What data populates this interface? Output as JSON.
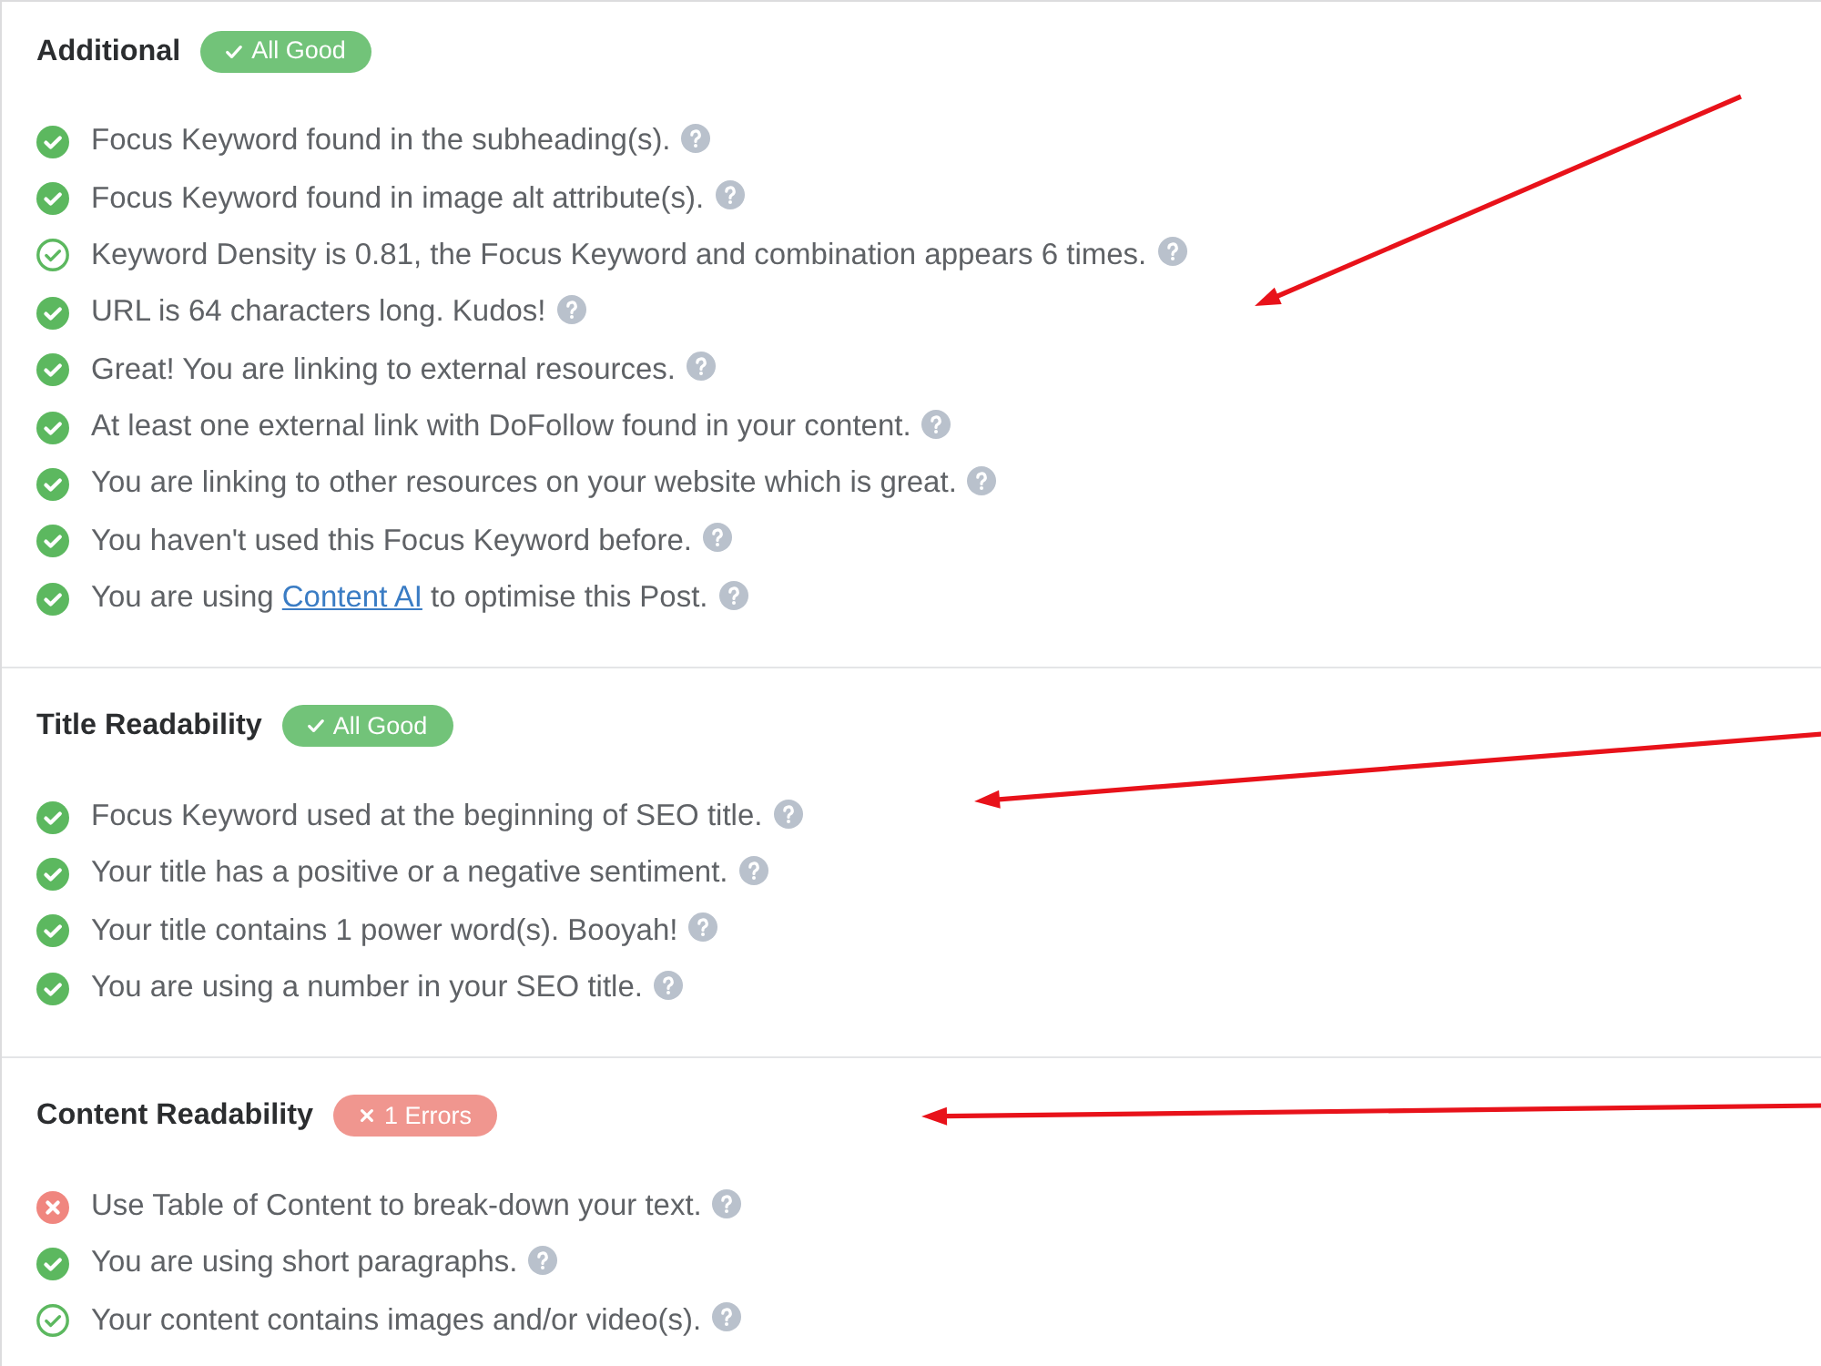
{
  "sections": [
    {
      "title": "Additional",
      "badge": {
        "has_errors": false,
        "label": "All Good"
      },
      "annotation_arrow": true,
      "items": [
        {
          "passed": true,
          "outlined": false,
          "text": "Focus Keyword found in the subheading(s)."
        },
        {
          "passed": true,
          "outlined": false,
          "text": "Focus Keyword found in image alt attribute(s)."
        },
        {
          "passed": true,
          "outlined": true,
          "text": "Keyword Density is 0.81, the Focus Keyword and combination appears 6 times."
        },
        {
          "passed": true,
          "outlined": false,
          "text": "URL is 64 characters long. Kudos!"
        },
        {
          "passed": true,
          "outlined": false,
          "text": "Great! You are linking to external resources."
        },
        {
          "passed": true,
          "outlined": false,
          "text": "At least one external link with DoFollow found in your content."
        },
        {
          "passed": true,
          "outlined": false,
          "text": "You are linking to other resources on your website which is great."
        },
        {
          "passed": true,
          "outlined": false,
          "text": "You haven't used this Focus Keyword before."
        },
        {
          "passed": true,
          "outlined": false,
          "segments": [
            {
              "kind": "plain",
              "text": "You are using "
            },
            {
              "kind": "link",
              "text": "Content AI"
            },
            {
              "kind": "plain",
              "text": " to optimise this Post."
            }
          ]
        }
      ]
    },
    {
      "title": "Title Readability",
      "badge": {
        "has_errors": false,
        "label": "All Good"
      },
      "annotation_arrow": true,
      "items": [
        {
          "passed": true,
          "outlined": false,
          "text": "Focus Keyword used at the beginning of SEO title."
        },
        {
          "passed": true,
          "outlined": false,
          "text": "Your title has a positive or a negative sentiment."
        },
        {
          "passed": true,
          "outlined": false,
          "text": "Your title contains 1 power word(s). Booyah!"
        },
        {
          "passed": true,
          "outlined": false,
          "text": "You are using a number in your SEO title."
        }
      ]
    },
    {
      "title": "Content Readability",
      "badge": {
        "has_errors": true,
        "label": "1 Errors"
      },
      "annotation_arrow": true,
      "items": [
        {
          "passed": false,
          "outlined": false,
          "text": "Use Table of Content to break-down your text."
        },
        {
          "passed": true,
          "outlined": false,
          "text": "You are using short paragraphs."
        },
        {
          "passed": true,
          "outlined": true,
          "text": "Your content contains images and/or video(s)."
        }
      ]
    }
  ]
}
